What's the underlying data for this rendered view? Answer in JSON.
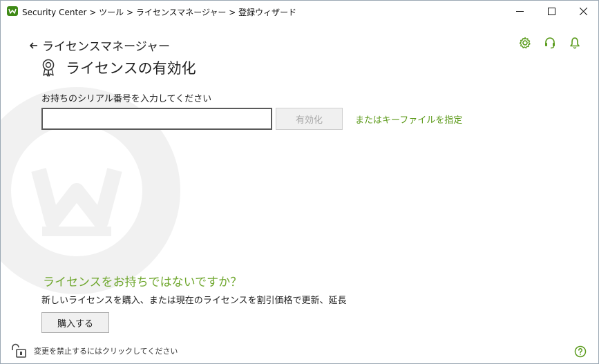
{
  "window": {
    "title": "Security Center > ツール > ライセンスマネージャー > 登録ウィザード"
  },
  "header": {
    "back_label": "ライセンスマネージャー",
    "page_title": "ライセンスの有効化",
    "icons": [
      "settings-gear-icon",
      "headset-support-icon",
      "bell-icon"
    ]
  },
  "form": {
    "serial_label": "お持ちのシリアル番号を入力してください",
    "serial_value": "",
    "activate_label": "有効化",
    "keyfile_link": "またはキーファイルを指定"
  },
  "no_license": {
    "heading": "ライセンスをお持ちではないですか？",
    "description": "新しいライセンスを購入、または現在のライセンスを割引価格で更新、延長",
    "buy_label": "購入する"
  },
  "footer": {
    "lock_text": "変更を禁止するにはクリックしてください"
  },
  "colors": {
    "accent_green": "#6fa72e",
    "link_green": "#5c9a1a",
    "icon_green": "#5a9b1c"
  }
}
